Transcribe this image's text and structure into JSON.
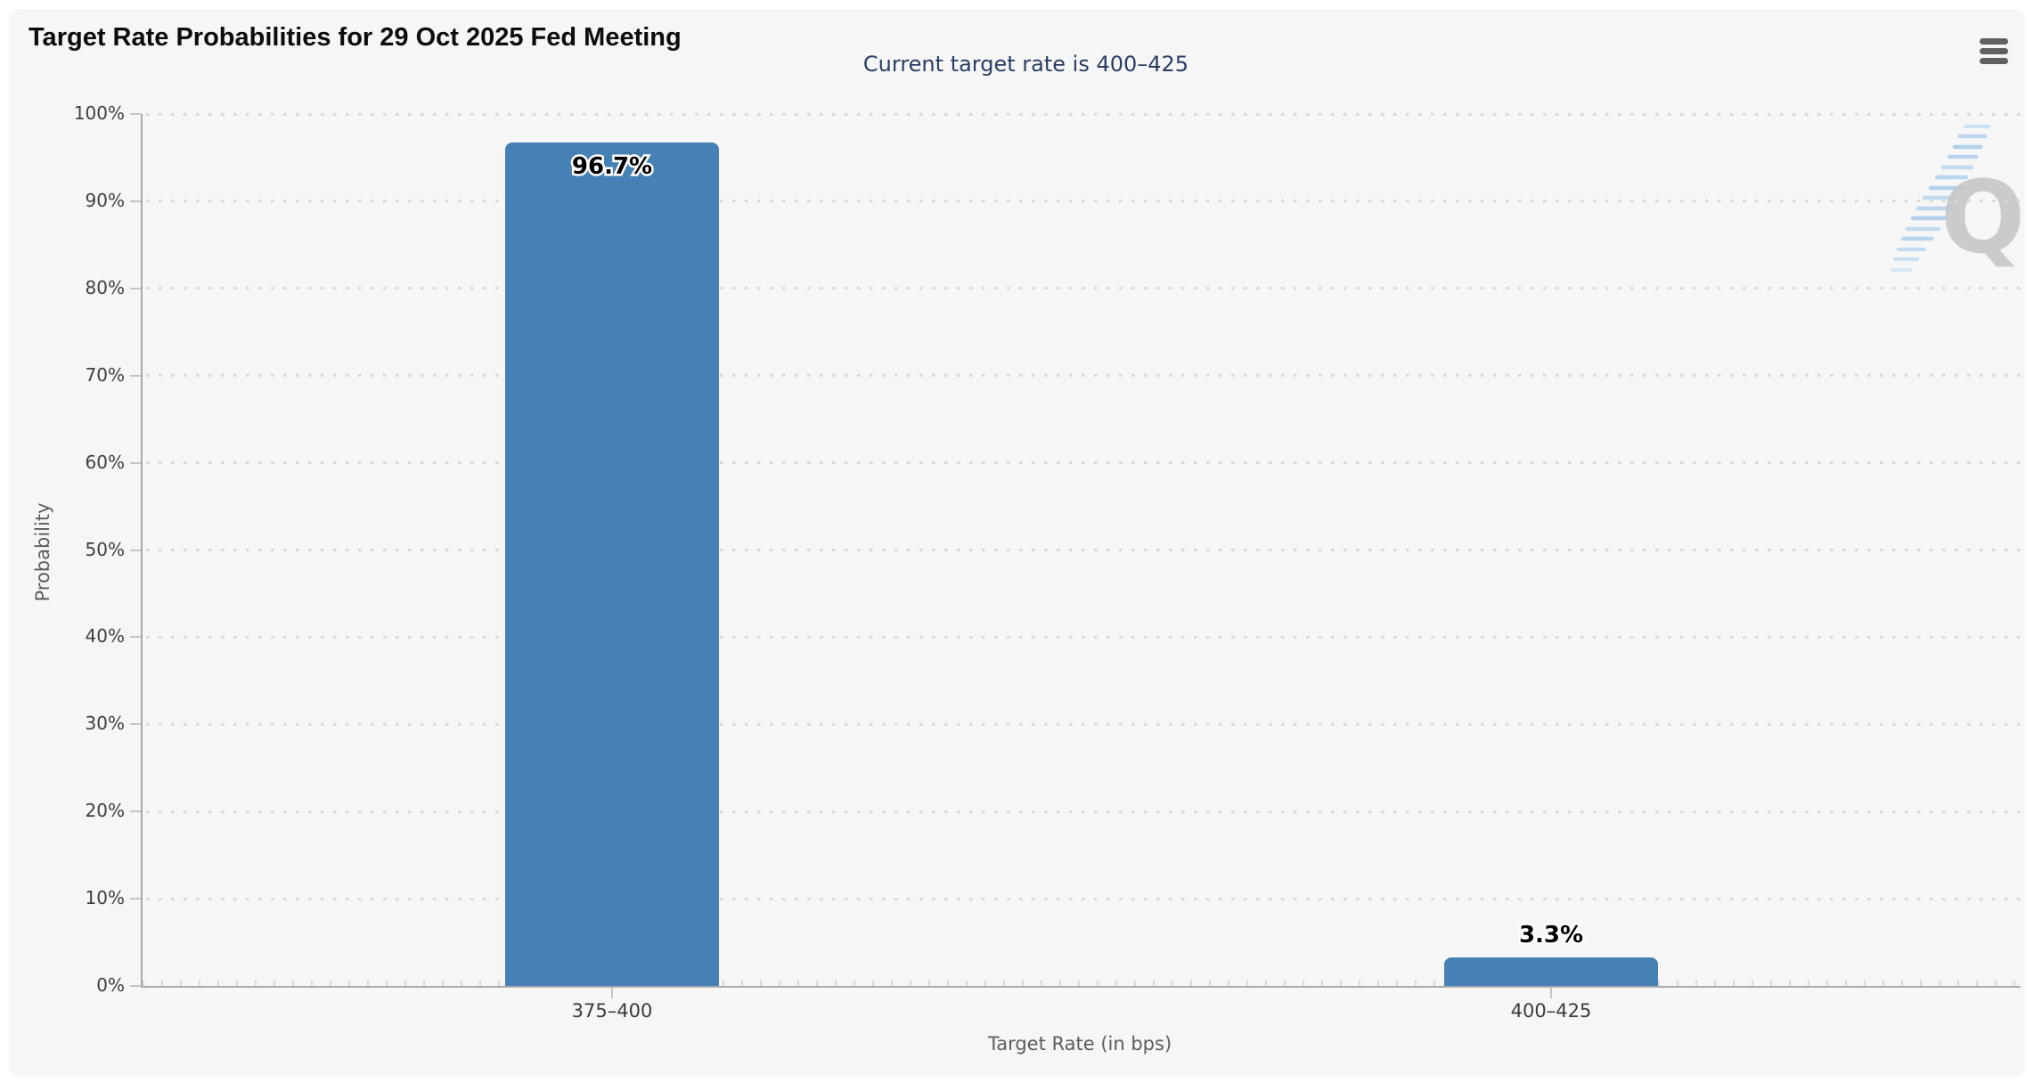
{
  "header": {
    "menu_icon": "hamburger-menu-icon"
  },
  "chart_data": {
    "type": "bar",
    "title": "Target Rate Probabilities for 29 Oct 2025 Fed Meeting",
    "subtitle": "Current target rate is 400–425",
    "categories": [
      "375–400",
      "400–425"
    ],
    "values": [
      96.7,
      3.3
    ],
    "data_labels": [
      "96.7%",
      "3.3%"
    ],
    "xlabel": "Target Rate (in bps)",
    "ylabel": "Probability",
    "ylim": [
      0,
      100
    ],
    "ytick_step": 10,
    "ytick_suffix": "%",
    "grid": "dotted-horizontal",
    "legend": "none",
    "bar_color": "#4681b5",
    "subtitle_color": "#2a3e63",
    "watermark_letter": "Q"
  }
}
